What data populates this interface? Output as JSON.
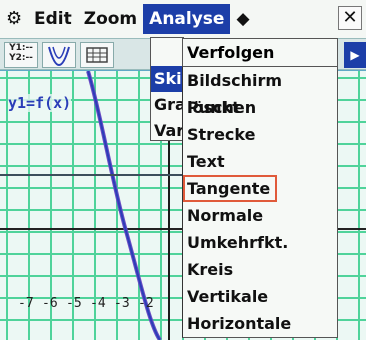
{
  "menubar": {
    "gear": "⚙",
    "items": [
      "Edit",
      "Zoom",
      "Analyse",
      "◆"
    ],
    "close": "✕"
  },
  "toolbar": {
    "btn1": "Y1:--\nY2:--",
    "scroll": "▶"
  },
  "graph": {
    "func_label": "y1=f(x)",
    "ticks": [
      "-7",
      "-6",
      "-5",
      "-4",
      "-3",
      "-2"
    ]
  },
  "analyse_menu": {
    "items": [
      "Ski",
      "Gra",
      "Var"
    ]
  },
  "sub_menu": {
    "header": "Verfolgen",
    "items": [
      "Bildschirm löschen",
      "Punkt",
      "Strecke",
      "Text",
      "Tangente",
      "Normale",
      "Umkehrfkt.",
      "Kreis",
      "Vertikale",
      "Horizontale"
    ]
  },
  "colors": {
    "accent": "#1c3ea8",
    "grid": "#4fd39a",
    "highlight": "#e05a3a",
    "curve": "#2b3eb8"
  }
}
